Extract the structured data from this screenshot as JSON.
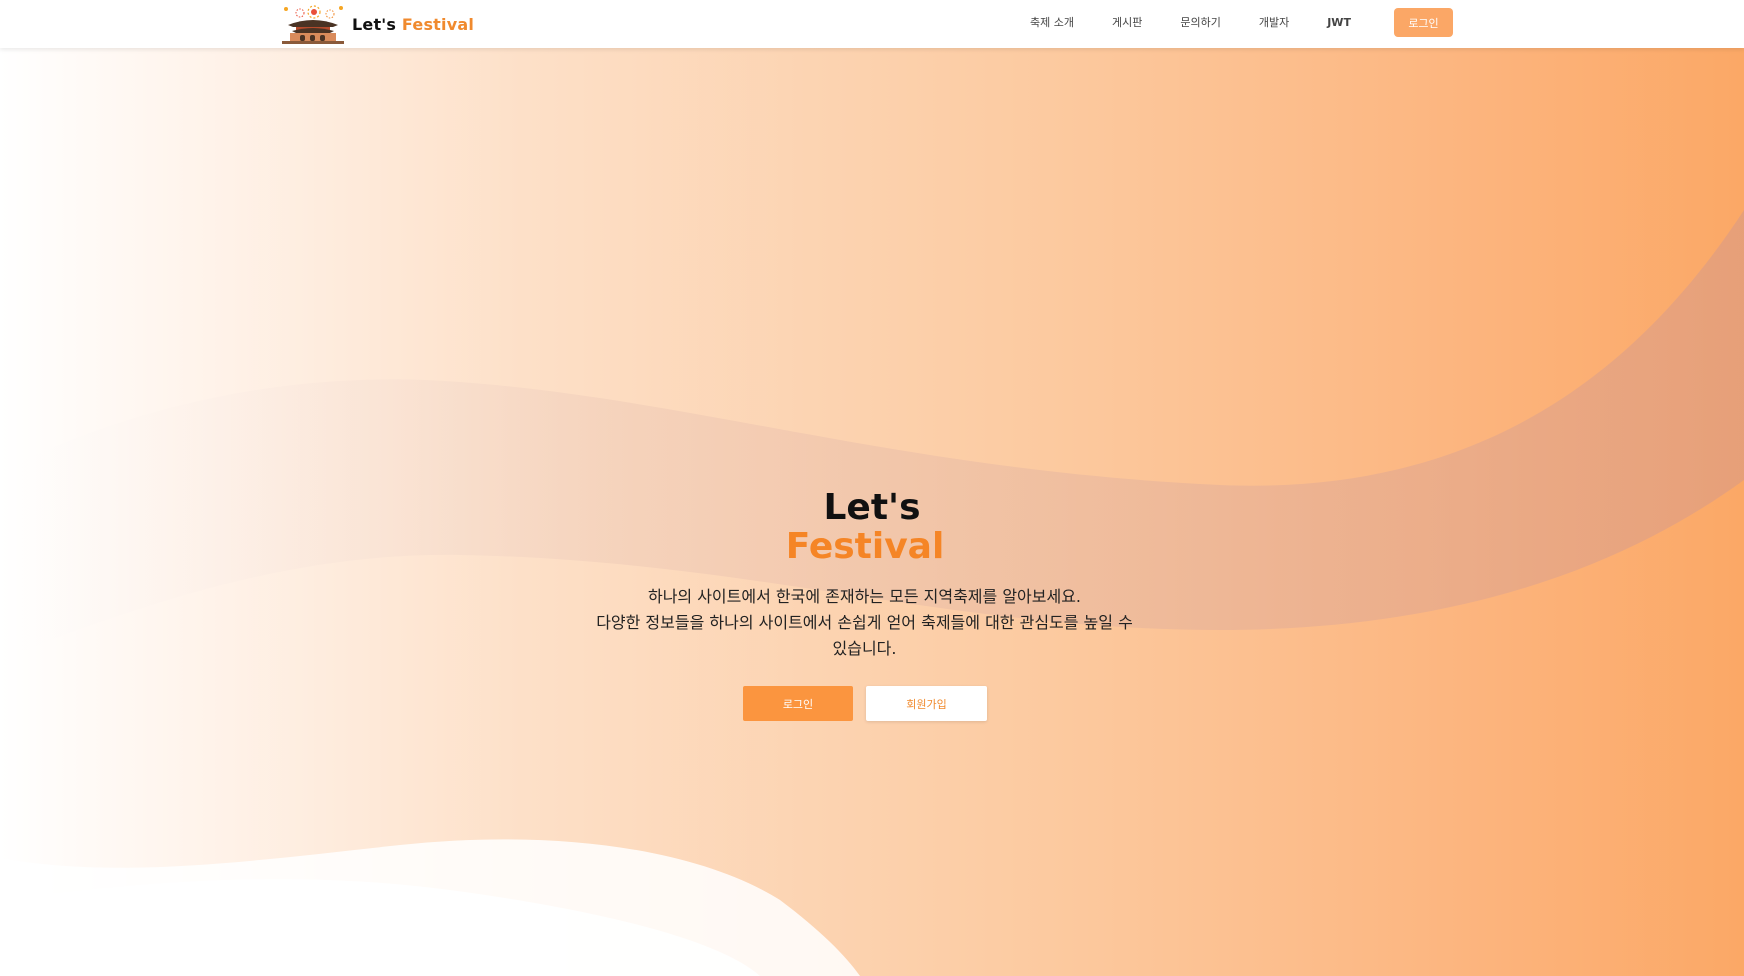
{
  "brand": {
    "name_part1": "Let's",
    "name_part2": "Festival"
  },
  "nav": {
    "items": [
      {
        "label": "축제 소개"
      },
      {
        "label": "게시판"
      },
      {
        "label": "문의하기"
      },
      {
        "label": "개발자"
      },
      {
        "label": "JWT"
      }
    ],
    "login_label": "로그인"
  },
  "hero": {
    "title_line1": "Let's",
    "title_line2": "Festival",
    "description_line1": "하나의 사이트에서 한국에 존재하는 모든 지역축제를 알아보세요.",
    "description_line2": "다양한 정보들을 하나의 사이트에서 손쉽게 얻어 축제들에 대한 관심도를 높일 수 있습니다.",
    "login_button": "로그인",
    "signup_button": "회원가입"
  },
  "colors": {
    "accent": "#f58526",
    "button": "#fb953f",
    "nav_button": "#fba766"
  },
  "icons": {
    "logo": "festival-palace-fireworks-icon"
  }
}
